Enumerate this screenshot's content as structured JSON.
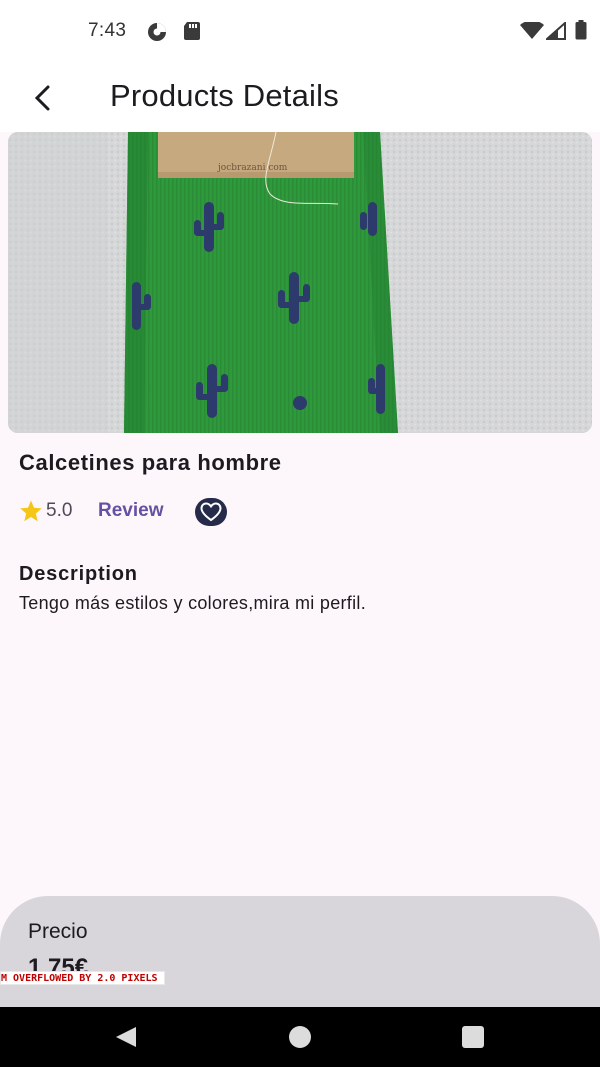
{
  "status_bar": {
    "time": "7:43",
    "icons": [
      "data-saver-icon",
      "sd-card-icon",
      "wifi-icon",
      "signal-icon",
      "battery-icon"
    ]
  },
  "app_bar": {
    "back_icon": "arrow-back-icon",
    "title": "Products Details"
  },
  "product": {
    "image_desc": "green-socks-photo",
    "tag_text": "jocbrazani.com",
    "name": "Calcetines para hombre",
    "rating": "5.0",
    "review_label": "Review",
    "favorite_icon": "heart-outline-icon",
    "description_title": "Description",
    "description": "Tengo más estilos y colores,mira mi perfil."
  },
  "price_panel": {
    "label": "Precio",
    "value": "1,75€"
  },
  "debug_banner": "M OVERFLOWED BY 2.0 PIXELS",
  "nav_bar": {
    "buttons": [
      "back-triangle-icon",
      "home-circle-icon",
      "recents-square-icon"
    ]
  },
  "colors": {
    "background": "#fdf7fb",
    "accent": "#6650a4",
    "star": "#f5c518",
    "favorite_bg": "#252b48",
    "panel": "#d8d5db"
  }
}
